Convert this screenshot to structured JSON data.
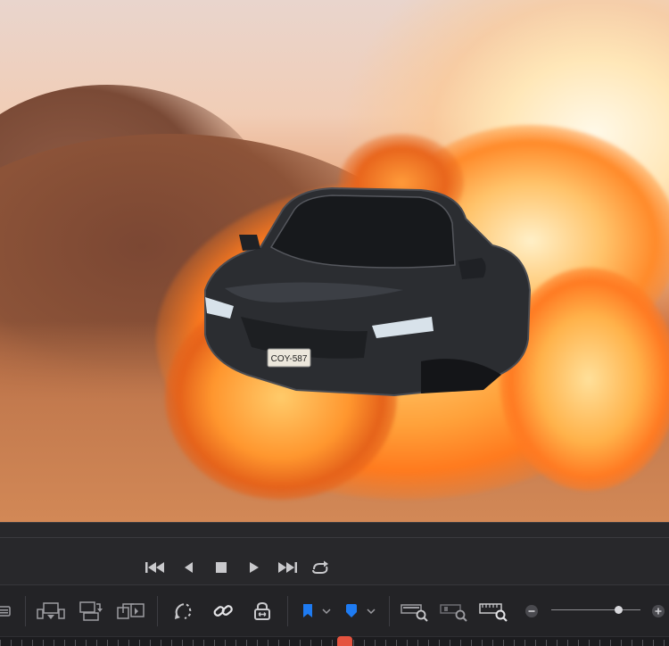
{
  "viewer": {
    "scene": "car-in-fire-frame",
    "license_plate": "COY-587",
    "colors": {
      "fire": "#ff8a2a",
      "sky": "#f1cdb6",
      "car": "#2b2d31"
    }
  },
  "transport": {
    "buttons": [
      {
        "name": "go-to-start",
        "icon": "skip-to-start-icon"
      },
      {
        "name": "play-reverse",
        "icon": "play-reverse-icon"
      },
      {
        "name": "stop",
        "icon": "stop-icon"
      },
      {
        "name": "play",
        "icon": "play-icon"
      },
      {
        "name": "go-to-end",
        "icon": "skip-to-end-icon"
      },
      {
        "name": "loop",
        "icon": "loop-icon"
      }
    ]
  },
  "toolbar": {
    "tools": [
      "timeline-view-icon",
      "insert-clip-icon",
      "overwrite-clip-icon",
      "replace-clip-icon",
      "dynamic-trim-icon",
      "link-icon",
      "position-lock-icon",
      "flag-icon",
      "marker-icon",
      "zoom-full-icon",
      "zoom-detail-icon",
      "zoom-custom-icon",
      "zoom-out-icon",
      "zoom-in-icon"
    ],
    "flag_color": "#1e7bf2",
    "marker_color": "#1e7bf2",
    "zoom_level": 0.78
  },
  "timeline": {
    "playhead_color": "#e5533f"
  }
}
